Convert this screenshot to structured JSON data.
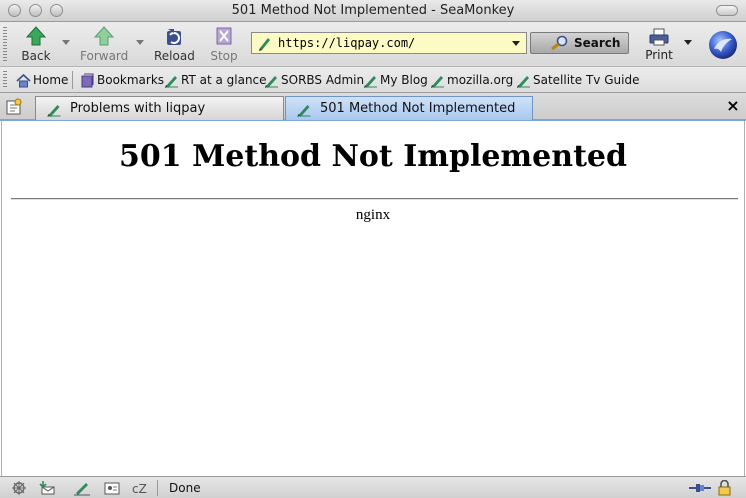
{
  "window": {
    "title": "501 Method Not Implemented - SeaMonkey"
  },
  "nav": {
    "back_label": "Back",
    "forward_label": "Forward",
    "reload_label": "Reload",
    "stop_label": "Stop",
    "url": "https://liqpay.com/",
    "search_label": "Search",
    "print_label": "Print"
  },
  "bookmarks": {
    "items": [
      {
        "label": "Home",
        "icon": "home-icon"
      },
      {
        "label": "Bookmarks",
        "icon": "bookmarks-icon"
      },
      {
        "label": "RT at a glance",
        "icon": "bookmark-page-icon"
      },
      {
        "label": "SORBS Admin",
        "icon": "bookmark-page-icon"
      },
      {
        "label": "My Blog",
        "icon": "bookmark-page-icon"
      },
      {
        "label": "mozilla.org",
        "icon": "bookmark-page-icon"
      },
      {
        "label": "Satellite Tv Guide",
        "icon": "bookmark-page-icon"
      }
    ]
  },
  "tabs": [
    {
      "label": "Problems with liqpay",
      "active": false
    },
    {
      "label": "501 Method Not Implemented",
      "active": true
    }
  ],
  "page": {
    "heading": "501 Method Not Implemented",
    "server": "nginx"
  },
  "status": {
    "text": "Done"
  },
  "colors": {
    "url_background": "#fdfbc4",
    "active_tab": "#a9c8ef",
    "tab_underline": "#7ea6d6"
  }
}
